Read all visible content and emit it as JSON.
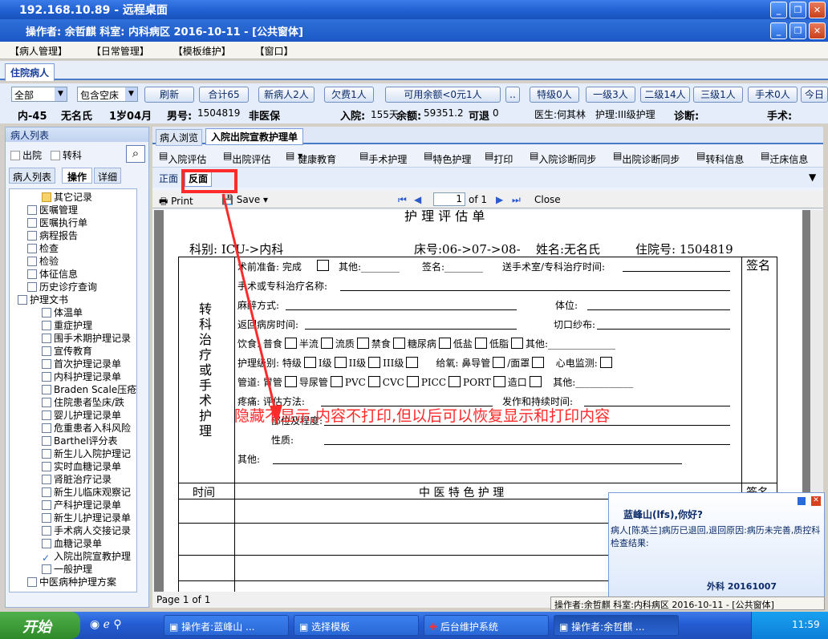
{
  "window": {
    "title": "192.168.10.89 - 远程桌面",
    "app_header": "操作者: 余哲麒    科室: 内科病区    2016-10-11 - [公共窗体]"
  },
  "menu": [
    "【病人管理】",
    "【日常管理】",
    "【模板维护】",
    "【窗口】"
  ],
  "doc_tab": "住院病人",
  "filters": {
    "scope": "全部",
    "bed": "包含空床",
    "buttons": [
      "刷新",
      "合计65",
      "新病人2人",
      "欠费1人",
      "可用余额<0元1人",
      "..",
      "特级0人",
      "一级3人",
      "二级14人",
      "三级1人",
      "手术0人",
      "今日"
    ]
  },
  "patient": {
    "bed": "内-45",
    "name": "无名氏",
    "age": "1岁04月",
    "sex": "男号:",
    "number": "1504819",
    "insurance": "非医保",
    "admit_label": "入院:",
    "admit_days": "155天",
    "balance_label": "余额:",
    "balance": "59351.2",
    "refund_label": "可退",
    "refund": "0",
    "doctor": "医生:何其林",
    "nursing": "护理:III级护理",
    "diagnosis": "诊断:",
    "surgery": "手术:"
  },
  "left_panel": {
    "title": "病人列表",
    "discharged": "出院",
    "transfer": "转科",
    "tabs": [
      "病人列表",
      "操作",
      "详细"
    ],
    "tree": [
      "其它记录",
      "医嘱管理",
      "医嘱执行单",
      "病程报告",
      "检查",
      "检验",
      "体征信息",
      "历史诊疗查询",
      "护理文书",
      "体温单",
      "重症护理",
      "围手术期护理记录",
      "宣传教育",
      "首次护理记录单",
      "内科护理记录单",
      "Braden Scale压疮",
      "住院患者坠床/跌",
      "婴儿护理记录单",
      "危重患者入科风险",
      "Barthel评分表",
      "新生儿入院护理记",
      "实时血糖记录单",
      "肾脏治疗记录",
      "新生儿临床观察记",
      "产科护理记录单",
      "新生儿护理记录单",
      "手术病人交接记录",
      "血糖记录单",
      "入院出院宣教护理",
      "一般护理",
      "中医病种护理方案"
    ]
  },
  "main_tabs": [
    "病人浏览",
    "入院出院宣教护理单"
  ],
  "toolbar": [
    "入院评估",
    "出院评估",
    "健康教育",
    "手术护理",
    "特色护理",
    "打印",
    "入院诊断同步",
    "出院诊断同步",
    "转科信息",
    "迁床信息"
  ],
  "side_tabs": [
    "正面",
    "反面"
  ],
  "viewer": {
    "print": "Print",
    "save": "Save",
    "page": "1",
    "of": "of 1",
    "close": "Close",
    "status": "Page 1 of 1"
  },
  "form": {
    "head_title": "护 理 评 估 单",
    "dept": "科别: ICU->内科",
    "bed_no": "床号:06->07->08-",
    "name": "姓名:无名氏",
    "admission_no": "住院号: 1504819",
    "sign": "签名",
    "left_label": "转科治疗或手术护理",
    "rows": [
      "术前准备: 完成",
      "其他:________",
      "签名:________",
      "送手术室/专科治疗时间:",
      "手术或专科治疗名称:",
      "麻醉方式:",
      "体位:",
      "返回病房时间:",
      "切口纱布:",
      "饮食: 普食",
      "半流",
      "流质",
      "禁食",
      "糖尿病",
      "低盐",
      "低脂",
      "其他:",
      "护理级别: 特级",
      "I级",
      "II级",
      "III级",
      "给氧: 鼻导管",
      "/面罩",
      "心电监测:",
      "管道: 胃管",
      "导尿管",
      "PVC",
      "CVC",
      "PICC",
      "PORT",
      "造口",
      "其他:",
      "疼痛: 评估方法:",
      "发作和持续时间:",
      "部位及程度:",
      "性质:",
      "其他:"
    ],
    "time_col": "时间",
    "tcm_title": "中 医 特 色 护 理",
    "sign2": "签名"
  },
  "annotation": "隐藏不显示,内容不打印,但以后可以恢复显示和打印内容",
  "popup": {
    "greet": "蓝峰山(lfs),你好?",
    "msg": "病人[陈英兰]病历已退回,退回原因:病历未完善,质控科检查结果:",
    "sender": "外科 20161007"
  },
  "statusbar": "操作者:余哲麒  科室:内科病区  2016-10-11 - [公共窗体]",
  "taskbar": {
    "start": "开始",
    "tasks": [
      "操作者:蓝峰山 ...",
      "选择模板",
      "后台维护系统",
      "操作者:余哲麒 ..."
    ],
    "clock": "11:59"
  }
}
